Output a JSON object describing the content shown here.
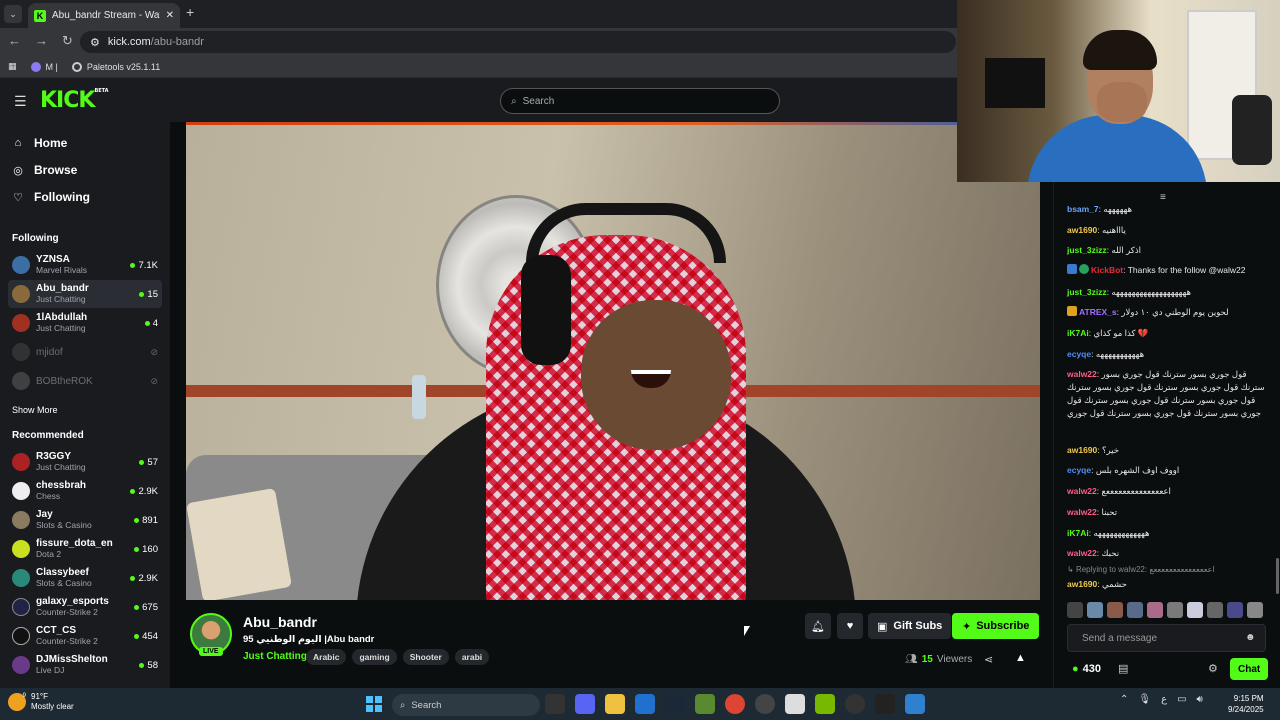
{
  "browser": {
    "tab_title": "Abu_bandr Stream - Watch Live",
    "tab_favicon": "K",
    "url_host": "kick.com",
    "url_path": "/abu-bandr",
    "bookmarks": [
      {
        "label": "M |"
      },
      {
        "label": "Paletools v25.1.11"
      }
    ]
  },
  "header": {
    "logo": "KICK",
    "logo_beta": "BETA",
    "search_placeholder": "Search"
  },
  "sidebar": {
    "nav": [
      {
        "label": "Home",
        "icon": "home-icon"
      },
      {
        "label": "Browse",
        "icon": "compass-icon"
      },
      {
        "label": "Following",
        "icon": "heart-icon"
      }
    ],
    "following_title": "Following",
    "following": [
      {
        "name": "YZNSA",
        "category": "Marvel Rivals",
        "viewers": "7.1K",
        "color": "#3b6ea5"
      },
      {
        "name": "Abu_bandr",
        "category": "Just Chatting",
        "viewers": "15",
        "color": "#8a6a3a"
      },
      {
        "name": "1lAbdullah",
        "category": "Just Chatting",
        "viewers": "4",
        "color": "#a03020"
      },
      {
        "name": "mjidof",
        "category": "",
        "viewers": "",
        "color": "#555555"
      },
      {
        "name": "BOBtheROK",
        "category": "",
        "viewers": "",
        "color": "#777777"
      }
    ],
    "show_more": "Show More",
    "recommended_title": "Recommended",
    "recommended": [
      {
        "name": "R3GGY",
        "category": "Just Chatting",
        "viewers": "57",
        "color": "#aa2222"
      },
      {
        "name": "chessbrah",
        "category": "Chess",
        "viewers": "2.9K",
        "color": "#eeeeee"
      },
      {
        "name": "Jay",
        "category": "Slots & Casino",
        "viewers": "891",
        "color": "#8a7a60"
      },
      {
        "name": "fissure_dota_en",
        "category": "Dota 2",
        "viewers": "160",
        "color": "#c8e020"
      },
      {
        "name": "Classybeef",
        "category": "Slots & Casino",
        "viewers": "2.9K",
        "color": "#2a8a7a"
      },
      {
        "name": "galaxy_esports",
        "category": "Counter-Strike 2",
        "viewers": "675",
        "color": "#222244"
      },
      {
        "name": "CCT_CS",
        "category": "Counter-Strike 2",
        "viewers": "454",
        "color": "#111111"
      },
      {
        "name": "DJMissShelton",
        "category": "Live DJ",
        "viewers": "58",
        "color": "#6a3a8a"
      }
    ]
  },
  "stream": {
    "name": "Abu_bandr",
    "title": "95 اليوم الوطنيي |Abu bandr",
    "category": "Just Chatting",
    "live_badge": "LIVE",
    "tags": [
      "Arabic",
      "gaming",
      "Shooter",
      "arabi"
    ],
    "gift_label": "Gift Subs",
    "subscribe_label": "Subscribe",
    "viewers_count": "15",
    "viewers_label": "Viewers"
  },
  "chat": {
    "messages": [
      {
        "user": "bsam_7",
        "text": "ههههههه",
        "color": "#6aa5ff"
      },
      {
        "user": "aw1690",
        "text": "ياااهنيه",
        "color": "#f2c94c"
      },
      {
        "user": "just_3zizz",
        "text": "اذكر الله",
        "color": "#53fc18"
      },
      {
        "user": "KickBot",
        "text": "Thanks for the follow @walw22",
        "color": "#e0303a"
      },
      {
        "user": "just_3zizz",
        "text": "هههههههههههههههههههه",
        "color": "#53fc18"
      },
      {
        "user": "ATREX_s",
        "text": "لحوين يوم الوطني دي ١٠ دولار",
        "color": "#a070ff"
      },
      {
        "user": "iK7Ai",
        "text": "كذا مو كذاي 💔",
        "color": "#53fc18"
      },
      {
        "user": "ecyqe",
        "text": "هههههههههههه",
        "color": "#4f8ef7"
      },
      {
        "user": "walw22",
        "text": "قول جوري بسور سترنك قول جوري بسور سترنك قول جوري بسور سترنك قول جوري بسور سترنك قول جوري بسور سترنك قول جوري بسور سترنك قول جوري بسور سترنك قول جوري بسور سترنك قول جوري",
        "color": "#ff5c8a"
      },
      {
        "user": "aw1690",
        "text": "خير؟",
        "color": "#f2c94c"
      },
      {
        "user": "ecyqe",
        "text": "اووف اوف الشهره بلس",
        "color": "#4f8ef7"
      },
      {
        "user": "walw22",
        "text": "اعععععععععععععععع",
        "color": "#ff5c8a"
      },
      {
        "user": "walw22",
        "text": "تحبنا",
        "color": "#ff5c8a"
      },
      {
        "user": "iK7Ai",
        "text": "هههههههههههههه",
        "color": "#53fc18"
      },
      {
        "user": "walw22",
        "text": "نحبك",
        "color": "#ff5c8a"
      },
      {
        "user": "aw1690",
        "text": "حشمي",
        "color": "#f2c94c"
      }
    ],
    "reply_text": "Replying to walw22: اعععععععععععععععع",
    "input_placeholder": "Send a message",
    "points": "430",
    "chat_button": "Chat"
  },
  "taskbar": {
    "weather_temp": "91°F",
    "weather_desc": "Mostly clear",
    "weather_badge": "9",
    "search_label": "Search",
    "time": "9:15 PM",
    "date": "9/24/2025",
    "tray_lang": "ع"
  }
}
